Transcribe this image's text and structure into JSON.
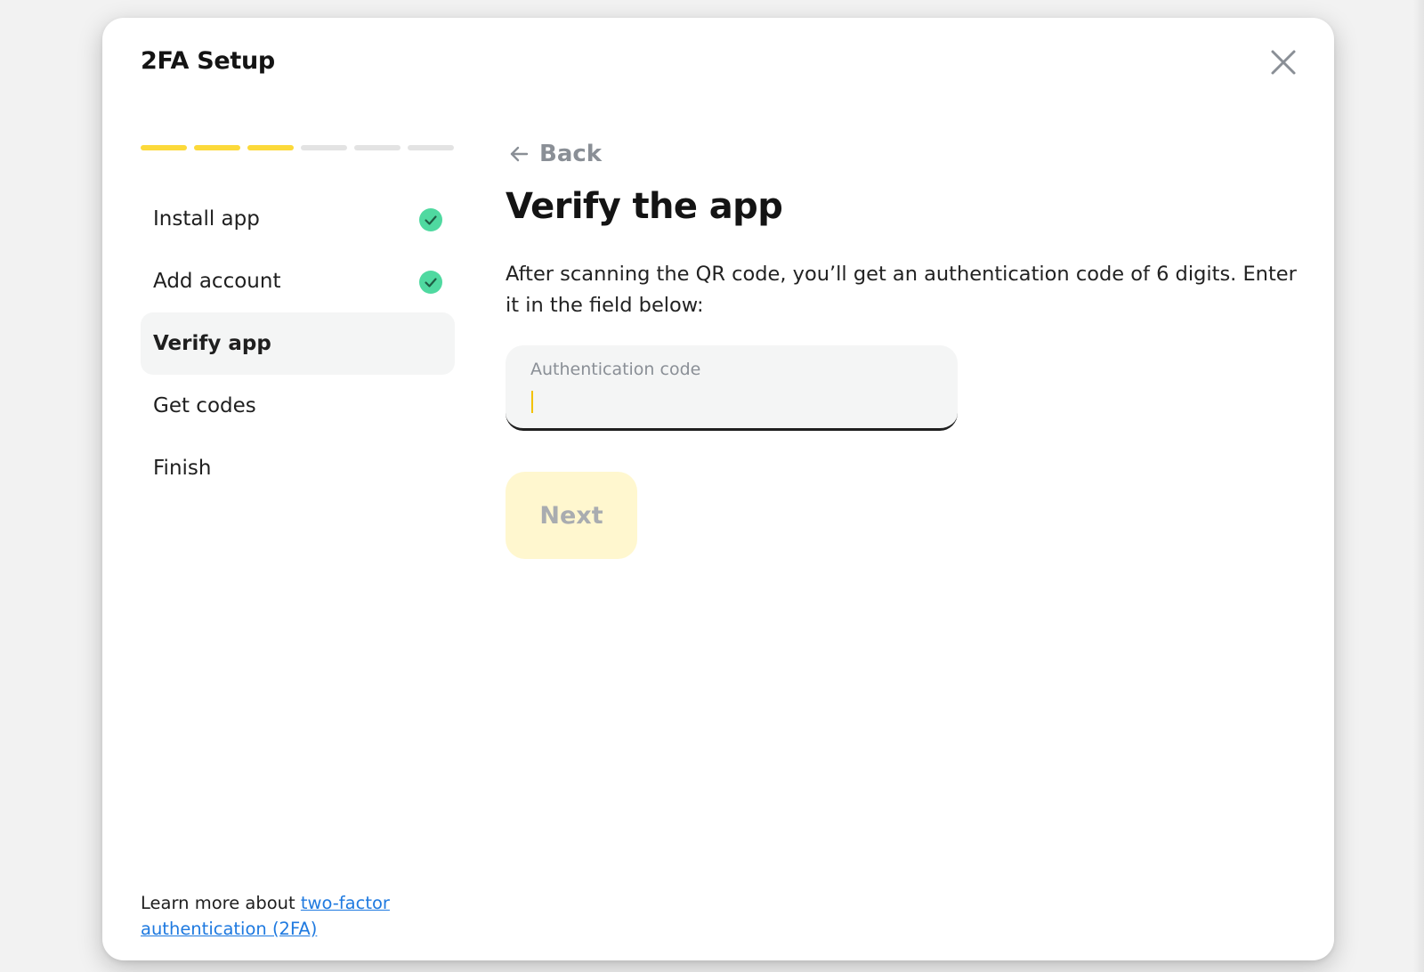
{
  "modal": {
    "title": "2FA Setup",
    "close_label": "Close"
  },
  "progress": {
    "total_segments": 6,
    "completed_segments": 3,
    "active_color": "#fcd93a",
    "inactive_color": "#e3e3e3"
  },
  "steps": [
    {
      "label": "Install app",
      "status": "complete"
    },
    {
      "label": "Add account",
      "status": "complete"
    },
    {
      "label": "Verify app",
      "status": "active"
    },
    {
      "label": "Get codes",
      "status": "pending"
    },
    {
      "label": "Finish",
      "status": "pending"
    }
  ],
  "footer": {
    "prefix": "Learn more about ",
    "link_text": "two-factor authentication (2FA)"
  },
  "content": {
    "back_label": "Back",
    "heading": "Verify the app",
    "description": "After scanning the QR code, you’ll get an authentication code of 6 digits. Enter it in the field below:",
    "field": {
      "label": "Authentication code",
      "value": ""
    },
    "next_label": "Next"
  },
  "colors": {
    "accent_yellow": "#fcd93a",
    "check_green": "#4fd9a0",
    "link_blue": "#1f7ae0",
    "disabled_button_bg": "#fff7cf"
  },
  "icons": {
    "close": "close-icon",
    "back": "arrow-left-icon",
    "complete": "check-circle-icon"
  }
}
